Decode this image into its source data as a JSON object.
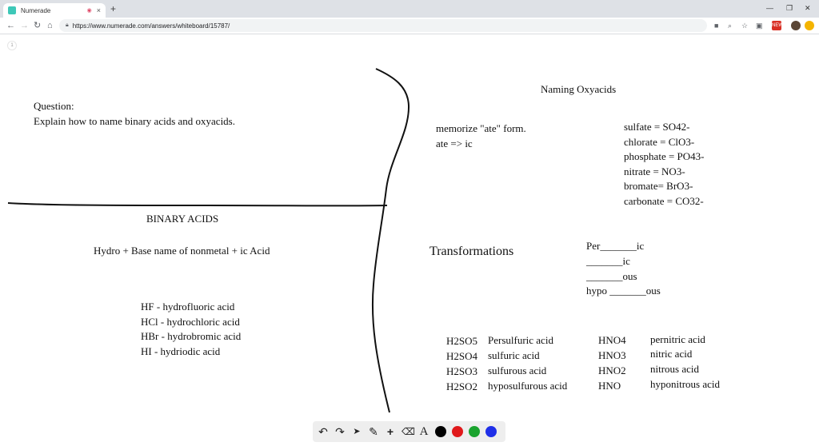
{
  "browser": {
    "tab_title": "Numerade",
    "audio_icon": "speaker-icon",
    "close_icon": "×",
    "new_tab": "+",
    "url": "https://www.numerade.com/answers/whiteboard/15787/",
    "minimize": "—",
    "restore": "❐",
    "close_window": "✕",
    "ext_badge": "NEW"
  },
  "board": {
    "page_number": "1",
    "question_label": "Question:",
    "question_text": "Explain how to name binary acids and oxyacids.",
    "binary": {
      "title": "BINARY ACIDS",
      "formula": "Hydro + Base name of nonmetal + ic Acid",
      "examples": [
        "HF - hydrofluoric acid",
        "HCl - hydrochloric acid",
        "HBr -  hydrobromic acid",
        "HI - hydriodic acid"
      ]
    },
    "oxy": {
      "title": "Naming Oxyacids",
      "memorize": [
        "memorize \"ate\" form.",
        "ate => ic"
      ],
      "ions": [
        "sulfate  =  SO42-",
        "chlorate  =  ClO3-",
        "phosphate  =  PO43-",
        "nitrate = NO3-",
        "bromate= BrO3-",
        "carbonate = CO32-"
      ],
      "transformations_label": "Transformations",
      "transformations": [
        "Per_______ic",
        "_______ic",
        "_______ous",
        "hypo _______ous"
      ],
      "sulfur_formulas": [
        "H2SO5",
        "H2SO4",
        "H2SO3",
        "H2SO2"
      ],
      "sulfur_names": [
        "Persulfuric acid",
        "sulfuric acid",
        "sulfurous acid",
        "hyposulfurous acid"
      ],
      "nitrogen_formulas": [
        "HNO4",
        "HNO3",
        "HNO2",
        "HNO"
      ],
      "nitrogen_names": [
        "pernitric acid",
        "nitric acid",
        "nitrous acid",
        "hyponitrous acid"
      ]
    }
  },
  "tools": {
    "undo": "↶",
    "redo": "↷",
    "pointer": "➤",
    "pen": "✎",
    "add": "+",
    "eraser": "⌫",
    "text": "A"
  },
  "colors": {
    "swatches": [
      "#000000",
      "#e0191b",
      "#1aa32e",
      "#1f2fe8"
    ],
    "ink": "#111111",
    "tab_favicon": "#3ec8b8"
  }
}
